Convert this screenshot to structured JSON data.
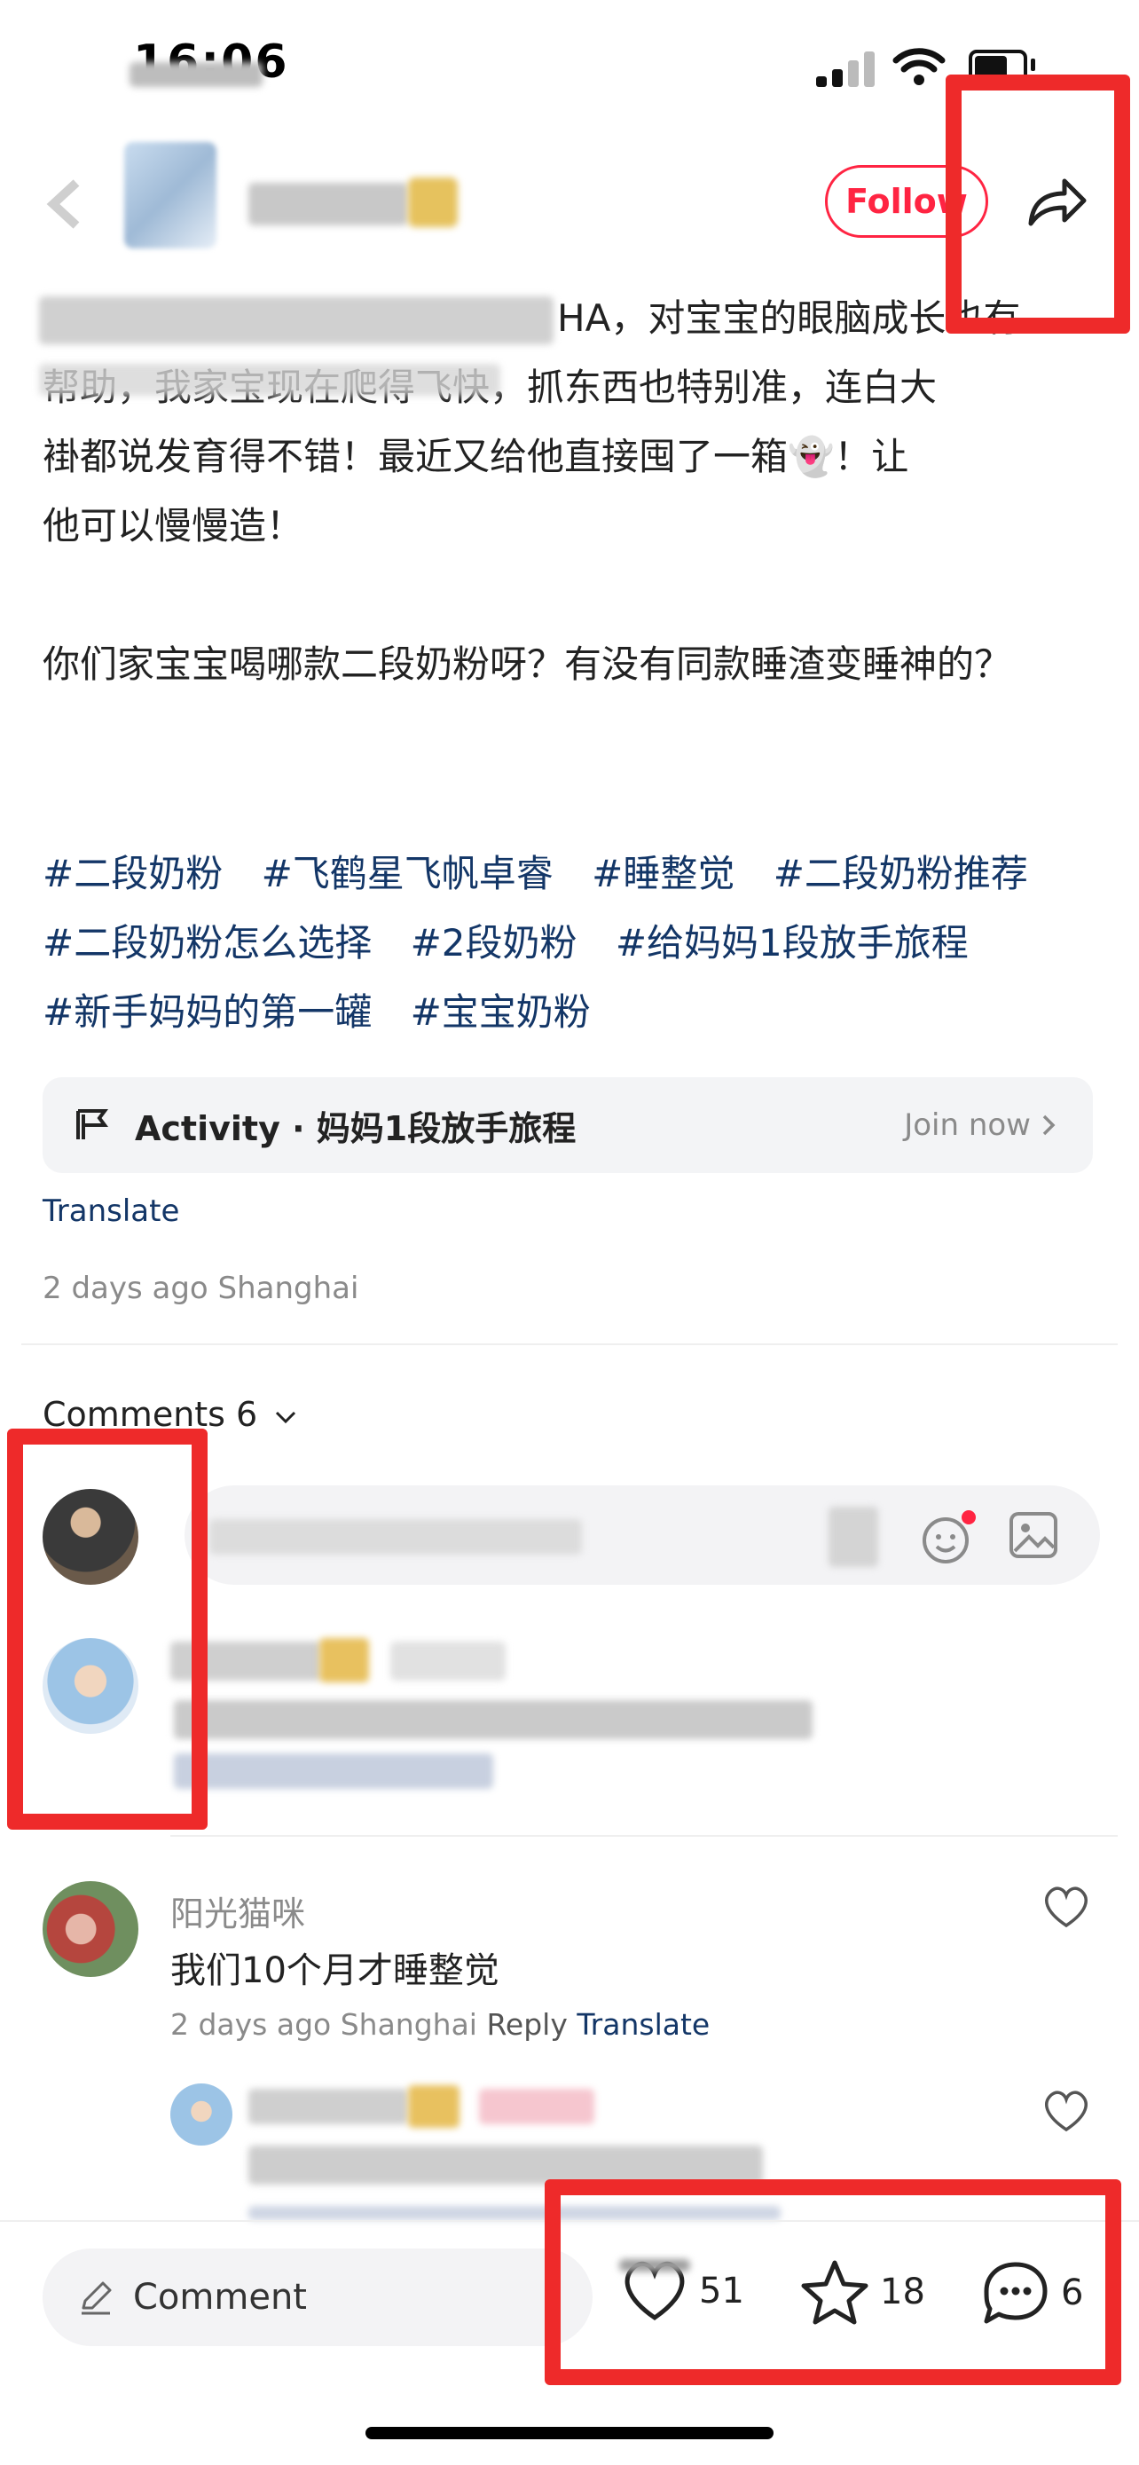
{
  "status_bar": {
    "time": "16:06"
  },
  "header": {
    "follow_label": "Follow"
  },
  "post": {
    "paragraph1_line1": "HA，对宝宝的眼脑成长也有",
    "paragraph1_line2": "帮助，我家宝现在爬得飞快，抓东西也特别准，连白大",
    "paragraph1_line3": "褂都说发育得不错！最近又给他直接囤了一箱👻！让",
    "paragraph1_line4": "他可以慢慢造！",
    "paragraph2": "你们家宝宝喝哪款二段奶粉呀？有没有同款睡渣变睡神的？",
    "tags": [
      "#二段奶粉",
      "#飞鹤星飞帆卓睿",
      "#睡整觉",
      "#二段奶粉推荐",
      "#二段奶粉怎么选择",
      "#2段奶粉",
      "#给妈妈1段放手旅程",
      "#新手妈妈的第一罐",
      "#宝宝奶粉"
    ],
    "activity": {
      "title": "Activity · 妈妈1段放手旅程",
      "join": "Join now"
    },
    "translate": "Translate",
    "meta": "2 days ago Shanghai"
  },
  "comments": {
    "header": "Comments 6",
    "items": [
      {
        "name": "阳光猫咪",
        "text": "我们10个月才睡整觉",
        "time": "2 days ago Shanghai",
        "reply": "Reply",
        "translate": "Translate"
      }
    ]
  },
  "bottom_bar": {
    "comment_placeholder": "Comment",
    "likes": "51",
    "favorites": "18",
    "comments": "6"
  },
  "colors": {
    "accent": "#ff2442",
    "link": "#133667",
    "annotation": "#ee2a2a"
  }
}
